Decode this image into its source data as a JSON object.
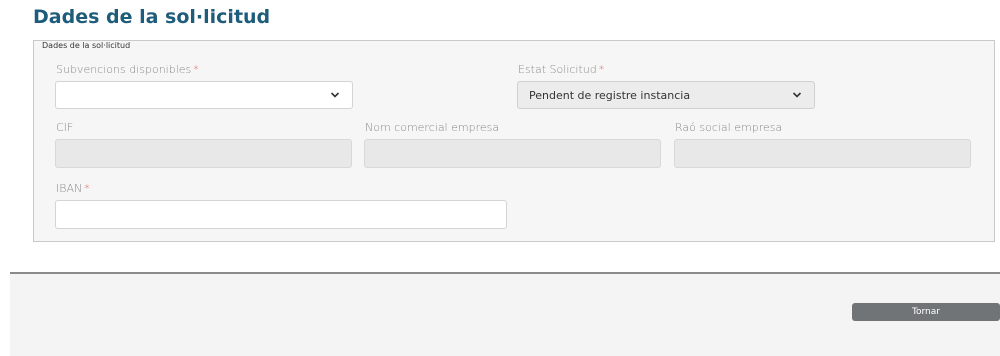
{
  "page": {
    "title": "Dades de la sol·licitud"
  },
  "form": {
    "legend": "Dades de la sol·licitud",
    "subvencions": {
      "label": "Subvencions disponibles",
      "required_mark": "*",
      "value": "",
      "icon": "chevron-down-icon"
    },
    "estat": {
      "label": "Estat Solicitud",
      "required_mark": "*",
      "value": "Pendent de registre instancia",
      "icon": "chevron-down-icon"
    },
    "cif": {
      "label": "CIF",
      "value": ""
    },
    "nom_comercial": {
      "label": "Nom comercial empresa",
      "value": ""
    },
    "rao_social": {
      "label": "Raó social empresa",
      "value": ""
    },
    "iban": {
      "label": "IBAN",
      "required_mark": "*",
      "value": ""
    }
  },
  "footer": {
    "tornar_label": "Tornar"
  },
  "colors": {
    "title": "#1d5c7a",
    "required": "#d9534f",
    "button": "#707477"
  }
}
